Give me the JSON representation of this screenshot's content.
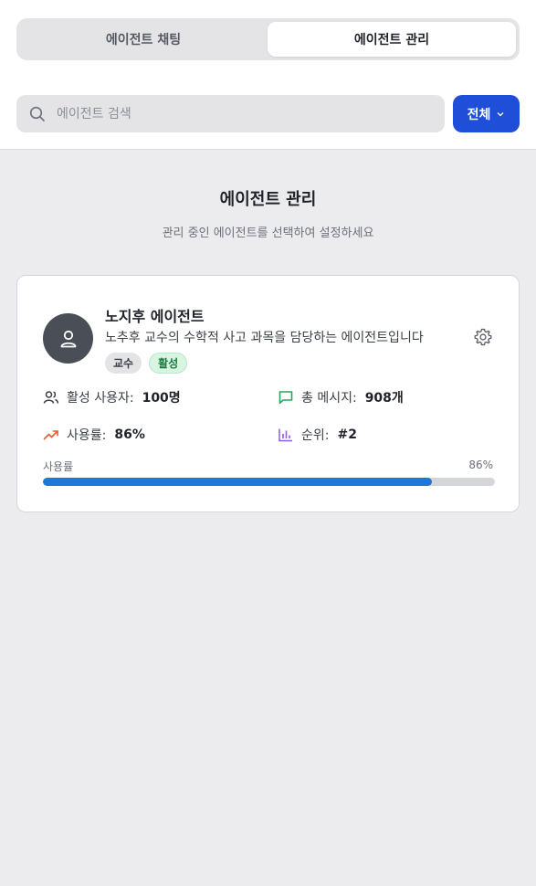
{
  "tabs": {
    "chat": "에이전트 채팅",
    "manage": "에이전트 관리"
  },
  "search": {
    "placeholder": "에이전트 검색",
    "value": ""
  },
  "filter": {
    "label": "전체"
  },
  "page": {
    "title": "에이전트 관리",
    "subtitle": "관리 중인 에이전트를 선택하여 설정하세요"
  },
  "agent": {
    "name": "노지후 에이전트",
    "description": "노추후 교수의 수학적 사고 과목을 담당하는 에이전트입니다",
    "tags": [
      "교수",
      "활성"
    ],
    "stats": {
      "active_users_label": "활성 사용자:",
      "active_users_value": "100명",
      "messages_label": "총 메시지:",
      "messages_value": "908개",
      "usage_label": "사용률:",
      "usage_value": "86%",
      "rank_label": "순위:",
      "rank_value": "#2"
    },
    "usage_bar": {
      "label": "사용률",
      "value_text": "86%",
      "fraction": 0.86
    }
  },
  "colors": {
    "accent": "#1f4fd8",
    "progress": "#1f78d8",
    "active_badge": "#d8f5e2",
    "messages_icon": "#22a85a",
    "usage_icon": "#f05a28",
    "rank_icon": "#8b5cf6"
  },
  "icons": {
    "search": "search-icon",
    "filter": "chevron-down-icon",
    "avatar": "user-icon",
    "settings": "gear-icon",
    "users": "users-icon",
    "messages": "message-square-icon",
    "usage": "trending-up-icon",
    "rank": "bar-chart-icon"
  }
}
